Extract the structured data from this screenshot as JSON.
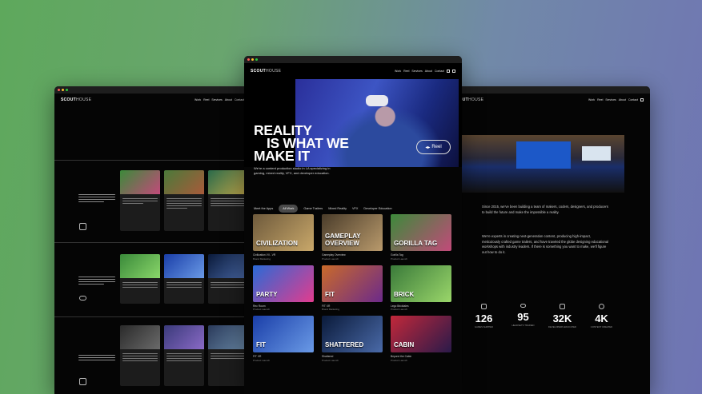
{
  "brand": {
    "logo_bold": "SCOUT",
    "logo_light": "HOUSE"
  },
  "nav": {
    "items": [
      "Work",
      "Reel",
      "Services",
      "About",
      "Contact"
    ]
  },
  "hero": {
    "title_lines": [
      "REALITY",
      "IS WHAT WE",
      "MAKE IT"
    ],
    "subtitle": "We're a content production studio in LA specializing in gaming, mixed reality, VFX, and developer education.",
    "reel_label": "Reel",
    "reel_icon": "play-icon"
  },
  "tabs": [
    "Meet the Apps",
    "All Work",
    "Game Trailers",
    "Mixed Reality",
    "VFX",
    "Developer Education"
  ],
  "active_tab": "All Work",
  "grid": [
    {
      "caption": "Civilization VII - VR",
      "sub": "Brand Marketing",
      "label": "CIVILIZATION",
      "color1": "#6e5a3c",
      "color2": "#c9a86a"
    },
    {
      "caption": "Gameplay Overview",
      "sub": "Product Launch",
      "label": "GAMEPLAY OVERVIEW",
      "color1": "#4a3c2a",
      "color2": "#b99a6c"
    },
    {
      "caption": "Gorilla Tag",
      "sub": "Product Launch",
      "label": "GORILLA TAG",
      "color1": "#3c8a3a",
      "color2": "#c24a7a"
    },
    {
      "caption": "Rec Room",
      "sub": "Product Launch",
      "label": "PARTY",
      "color1": "#2a6ad6",
      "color2": "#e23c8e"
    },
    {
      "caption": "FIT XR",
      "sub": "Brand Marketing",
      "label": "FIT",
      "color1": "#c96a2a",
      "color2": "#6c2a8a"
    },
    {
      "caption": "Lego Bricktales",
      "sub": "Product Launch",
      "label": "BRICK",
      "color1": "#3a7a3a",
      "color2": "#9ad66a"
    },
    {
      "caption": "FIT XR",
      "sub": "Product Launch",
      "label": "FIT",
      "color1": "#1a3ea8",
      "color2": "#6a9ae6"
    },
    {
      "caption": "Shattered",
      "sub": "Product Launch",
      "label": "SHATTERED",
      "color1": "#0a1a3a",
      "color2": "#4a6aa8"
    },
    {
      "caption": "Beyond the Cabin",
      "sub": "Product Launch",
      "label": "CABIN",
      "color1": "#c2283a",
      "color2": "#2a1a4a"
    }
  ],
  "left": {
    "sections": [
      {
        "icon": "sparkle-icon",
        "cards": [
          {
            "color": "#3c8a3a"
          },
          {
            "color": "#4a7a3a"
          },
          {
            "color": "#2a6a4a"
          }
        ]
      },
      {
        "icon": "headset-icon",
        "cards": [
          {
            "color": "#3a8a3a"
          },
          {
            "color": "#2a4ac6"
          },
          {
            "color": "#2a2a4a"
          }
        ]
      },
      {
        "icon": "image-icon",
        "cards": [
          {
            "color": "#3a3a3a"
          },
          {
            "color": "#3a3a7a"
          },
          {
            "color": "#2a3a5a"
          }
        ]
      }
    ]
  },
  "about": {
    "p1": "Since 2015, we've been building a team of makers, coders, designers, and producers to build the future and make the impossible a reality.",
    "p2": "We're experts in creating next-generation content, producing high-impact, meticulously crafted game trailers, and have traveled the globe designing educational workshops with industry leaders. If there is something you want to make, we'll figure out how to do it."
  },
  "stats": [
    {
      "icon": "sparkle-icon",
      "num": "126",
      "label": "GAMES SHIPPED"
    },
    {
      "icon": "headset-icon",
      "num": "95",
      "label": "HEADSETS TRAINED"
    },
    {
      "icon": "image-icon",
      "num": "32K",
      "label": "DEVELOPERS EDUCATED"
    },
    {
      "icon": "hex-icon",
      "num": "4K",
      "label": "CONTENT CREATED"
    }
  ]
}
